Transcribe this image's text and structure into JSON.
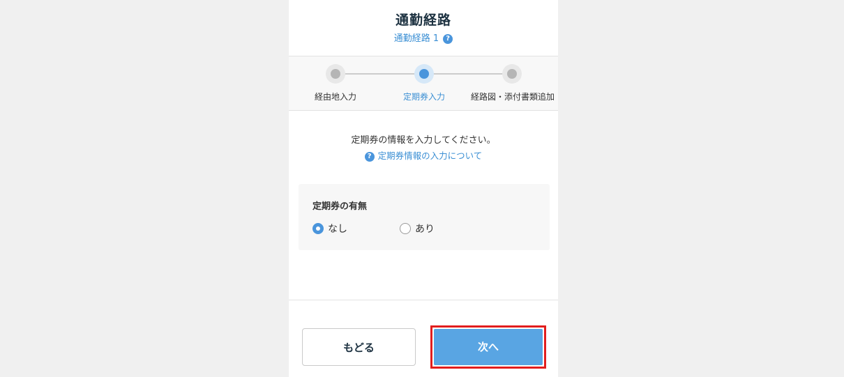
{
  "header": {
    "title": "通勤経路",
    "subtitle": "通勤経路 1",
    "help_icon_glyph": "?"
  },
  "stepper": {
    "current_step": 2,
    "steps": [
      {
        "label": "経由地入力",
        "state": "done"
      },
      {
        "label": "定期券入力",
        "state": "active"
      },
      {
        "label": "経路図・添付書類追加",
        "state": "pending"
      }
    ]
  },
  "content": {
    "instruction": "定期券の情報を入力してください。",
    "help_link_text": "定期券情報の入力について",
    "help_icon_glyph": "?"
  },
  "pass_section": {
    "label": "定期券の有無",
    "options": [
      {
        "label": "なし",
        "checked": true
      },
      {
        "label": "あり",
        "checked": false
      }
    ]
  },
  "footer": {
    "back_label": "もどる",
    "next_label": "次へ"
  },
  "colors": {
    "accent": "#4a95dc",
    "next_button": "#59a5e3",
    "highlight_border": "#e11e1e",
    "title": "#1c3140"
  }
}
